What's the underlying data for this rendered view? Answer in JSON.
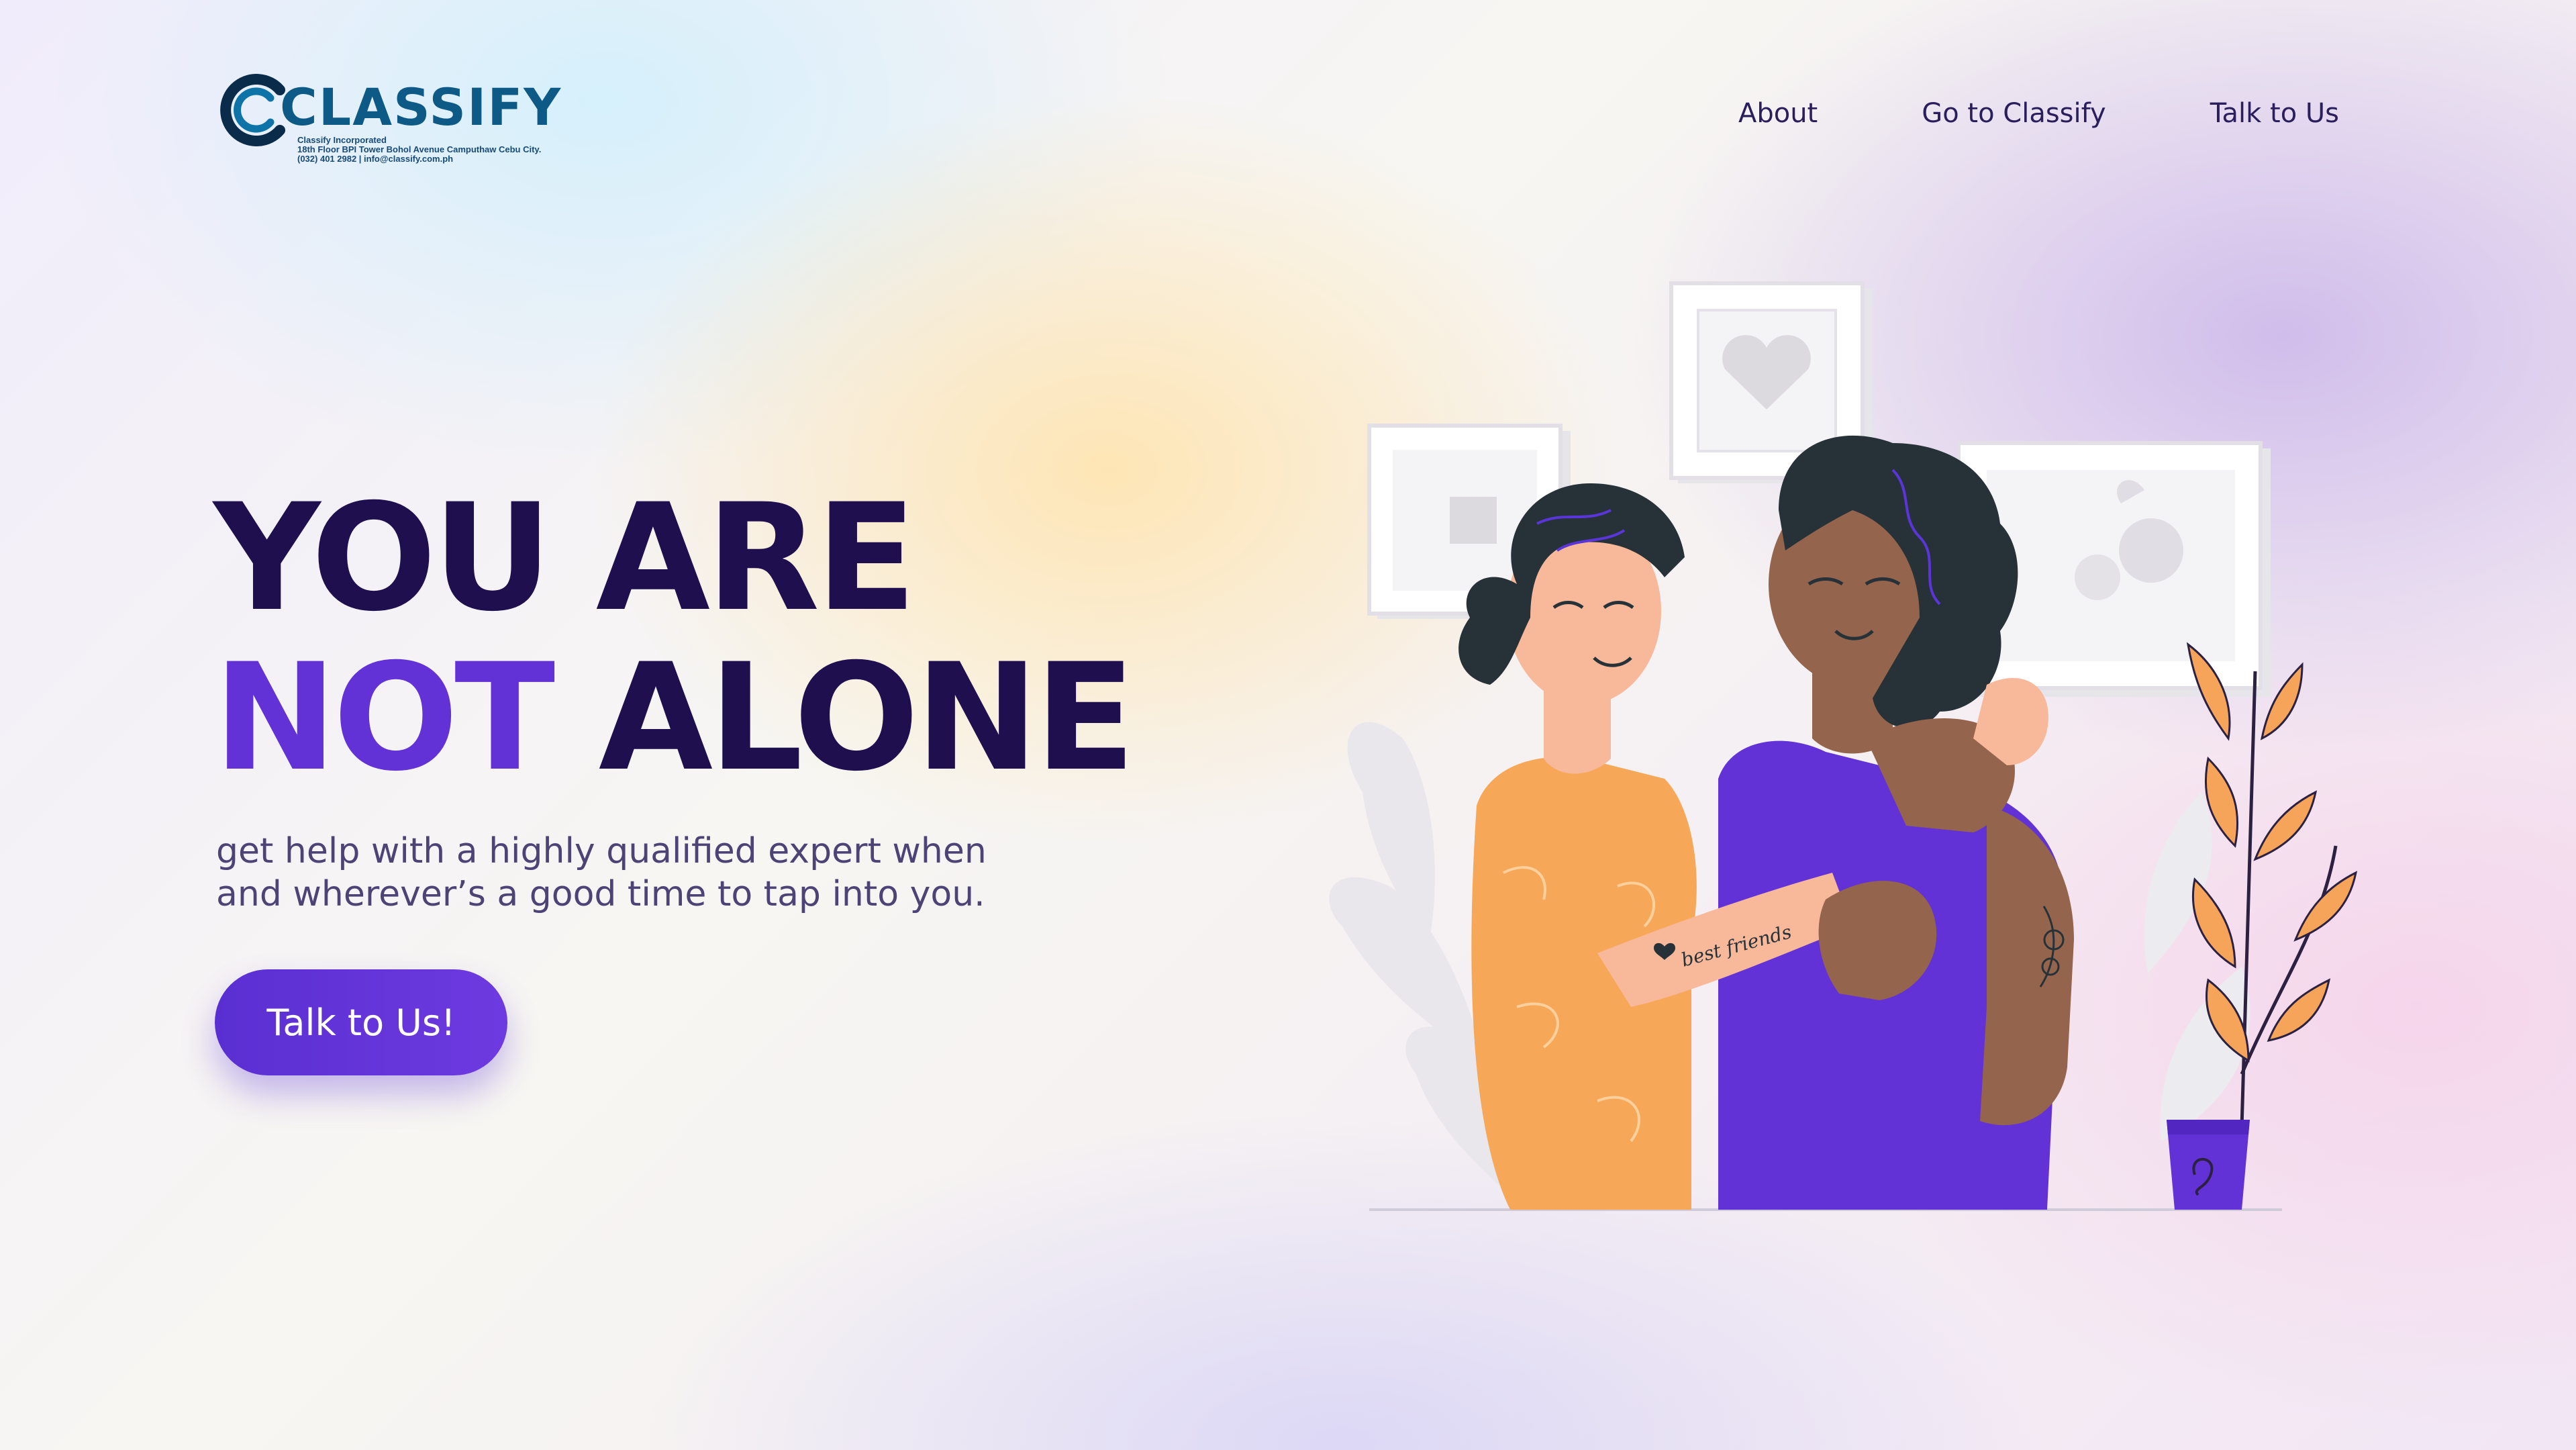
{
  "logo": {
    "wordmark": "CLASSIFY",
    "sub_lines": [
      "Classify Incorporated",
      "18th Floor BPI Tower Bohol Avenue Camputhaw Cebu City.",
      "(032) 401 2982  |  info@classify.com.ph"
    ]
  },
  "nav": {
    "items": [
      "About",
      "Go to Classify",
      "Talk to Us"
    ]
  },
  "hero": {
    "headline_line1": "YOU ARE",
    "headline_accent": "NOT",
    "headline_rest": "ALONE",
    "subtitle_line1": "get help with a highly qualified expert when",
    "subtitle_line2": "and wherever’s a good time to tap into you.",
    "cta_label": "Talk to Us!"
  },
  "illustration": {
    "tattoo_text": "best friends"
  },
  "colors": {
    "headline": "#1f0f4e",
    "accent": "#6232d6",
    "button": "#5a2fd2",
    "logo_blue": "#0e5a86"
  }
}
